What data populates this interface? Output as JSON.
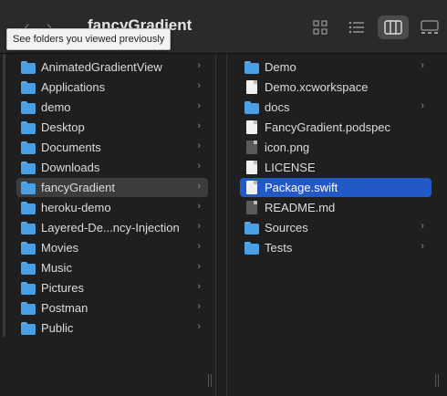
{
  "window": {
    "title": "fancyGradient",
    "tooltip": "See folders you viewed previously"
  },
  "toolbar": {
    "back_icon": "chevron-left-icon",
    "forward_icon": "chevron-right-icon",
    "view_modes": [
      "icon-view",
      "list-view",
      "column-view",
      "gallery-view"
    ],
    "active_view": "column-view"
  },
  "sidebar_column": {
    "items": [
      {
        "label": "AnimatedGradientView",
        "icon": "folder-icon"
      },
      {
        "label": "Applications",
        "icon": "folder-icon"
      },
      {
        "label": "demo",
        "icon": "folder-icon"
      },
      {
        "label": "Desktop",
        "icon": "folder-icon"
      },
      {
        "label": "Documents",
        "icon": "folder-icon"
      },
      {
        "label": "Downloads",
        "icon": "folder-icon"
      },
      {
        "label": "fancyGradient",
        "icon": "folder-icon",
        "selected": true
      },
      {
        "label": "heroku-demo",
        "icon": "folder-icon"
      },
      {
        "label": "Layered-De...ncy-Injection",
        "icon": "folder-icon"
      },
      {
        "label": "Movies",
        "icon": "folder-icon"
      },
      {
        "label": "Music",
        "icon": "folder-icon"
      },
      {
        "label": "Pictures",
        "icon": "folder-icon"
      },
      {
        "label": "Postman",
        "icon": "folder-icon"
      },
      {
        "label": "Public",
        "icon": "folder-icon"
      }
    ]
  },
  "content_column": {
    "items": [
      {
        "label": "Demo",
        "icon": "folder-icon",
        "has_children": true
      },
      {
        "label": "Demo.xcworkspace",
        "icon": "xcode-workspace-icon",
        "has_children": false
      },
      {
        "label": "docs",
        "icon": "folder-icon",
        "has_children": true
      },
      {
        "label": "FancyGradient.podspec",
        "icon": "document-icon",
        "has_children": false
      },
      {
        "label": "icon.png",
        "icon": "image-file-icon",
        "has_children": false
      },
      {
        "label": "LICENSE",
        "icon": "document-icon",
        "has_children": false
      },
      {
        "label": "Package.swift",
        "icon": "swift-file-icon",
        "has_children": false,
        "selected": true
      },
      {
        "label": "README.md",
        "icon": "markdown-file-icon",
        "has_children": false
      },
      {
        "label": "Sources",
        "icon": "folder-icon",
        "has_children": true
      },
      {
        "label": "Tests",
        "icon": "folder-icon",
        "has_children": true
      }
    ]
  },
  "colors": {
    "selection_blue": "#2358c7",
    "selection_gray": "#3c3c3c",
    "folder_blue": "#4aa0e6",
    "background": "#1f1f1f"
  }
}
